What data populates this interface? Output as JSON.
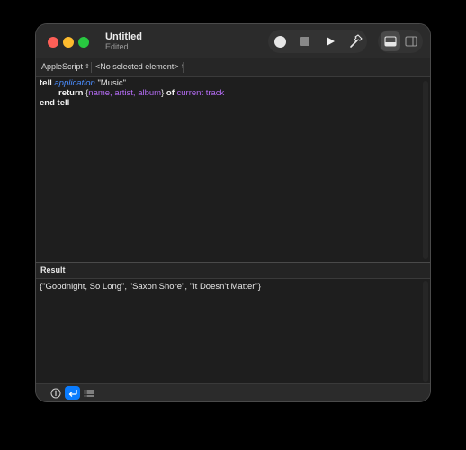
{
  "window": {
    "title": "Untitled",
    "subtitle": "Edited"
  },
  "toolbar": {
    "record_icon": "record-icon",
    "stop_icon": "stop-icon",
    "run_icon": "play-icon",
    "compile_icon": "hammer-icon",
    "view_bottom_icon": "bottom-panel-icon",
    "view_side_icon": "side-panel-icon"
  },
  "navbar": {
    "language": "AppleScript",
    "element": "<No selected element>"
  },
  "editor": {
    "line1": {
      "kw1": "tell",
      "app": "application",
      "str": "\"Music\""
    },
    "line2": {
      "kw": "return",
      "open": "{",
      "p1": "name",
      "c1": ", ",
      "p2": "artist",
      "c2": ", ",
      "p3": "album",
      "close": "}",
      "of": "of",
      "p4": "current track"
    },
    "line3": {
      "kw": "end tell"
    }
  },
  "result": {
    "title": "Result",
    "value": "{\"Goodnight, So Long\", \"Saxon Shore\", \"It Doesn't Matter\"}"
  },
  "bottom": {
    "info_icon": "info-icon",
    "reply_icon": "reply-arrow-icon",
    "list_icon": "list-icon"
  },
  "colors": {
    "accent": "#0a7cff",
    "keyword_app": "#4a8dff",
    "property": "#b56cf5"
  }
}
